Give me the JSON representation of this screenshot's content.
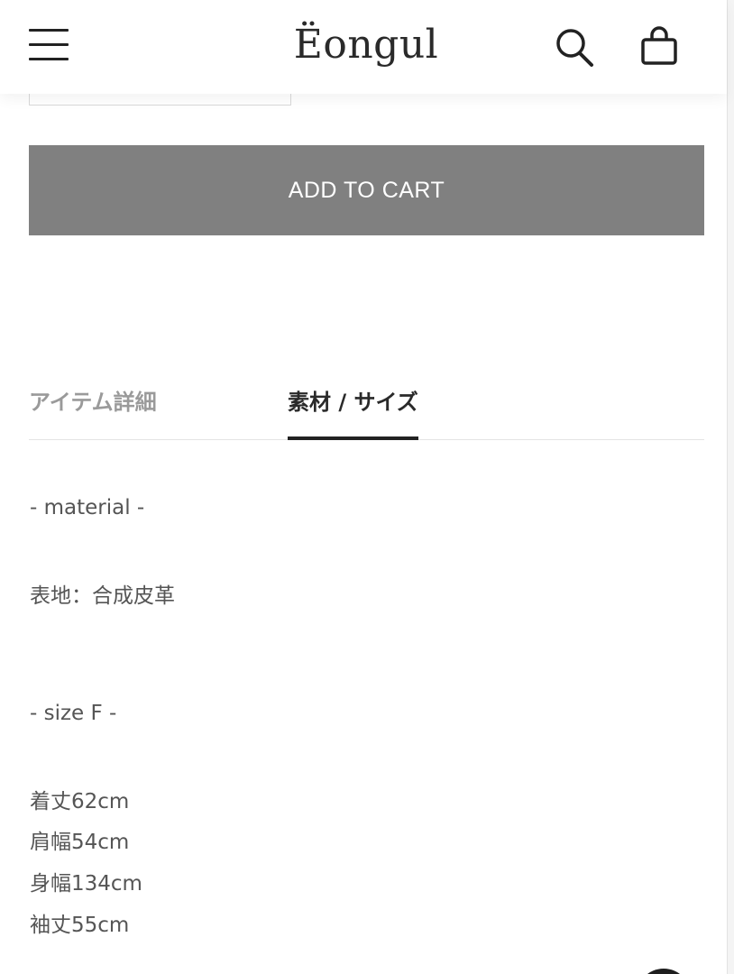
{
  "header": {
    "logo": "Ëongul",
    "menu_icon": "hamburger-menu-icon",
    "search_icon": "search-icon",
    "cart_icon": "shopping-bag-icon"
  },
  "product": {
    "add_to_cart_label": "ADD TO CART"
  },
  "tabs": [
    {
      "label": "アイテム詳細",
      "active": false
    },
    {
      "label": "素材 / サイズ",
      "active": true
    }
  ],
  "material": {
    "heading": "- material -",
    "fabric": "表地：合成皮革"
  },
  "size": {
    "heading": "- size F -",
    "measurements": [
      "着丈62cm",
      "肩幅54cm",
      "身幅134cm",
      "袖丈55cm"
    ]
  },
  "colors": {
    "button_bg": "#808080",
    "active_tab": "#2a2a2a",
    "inactive_tab": "#9a9a9a",
    "body_text": "#555555"
  }
}
